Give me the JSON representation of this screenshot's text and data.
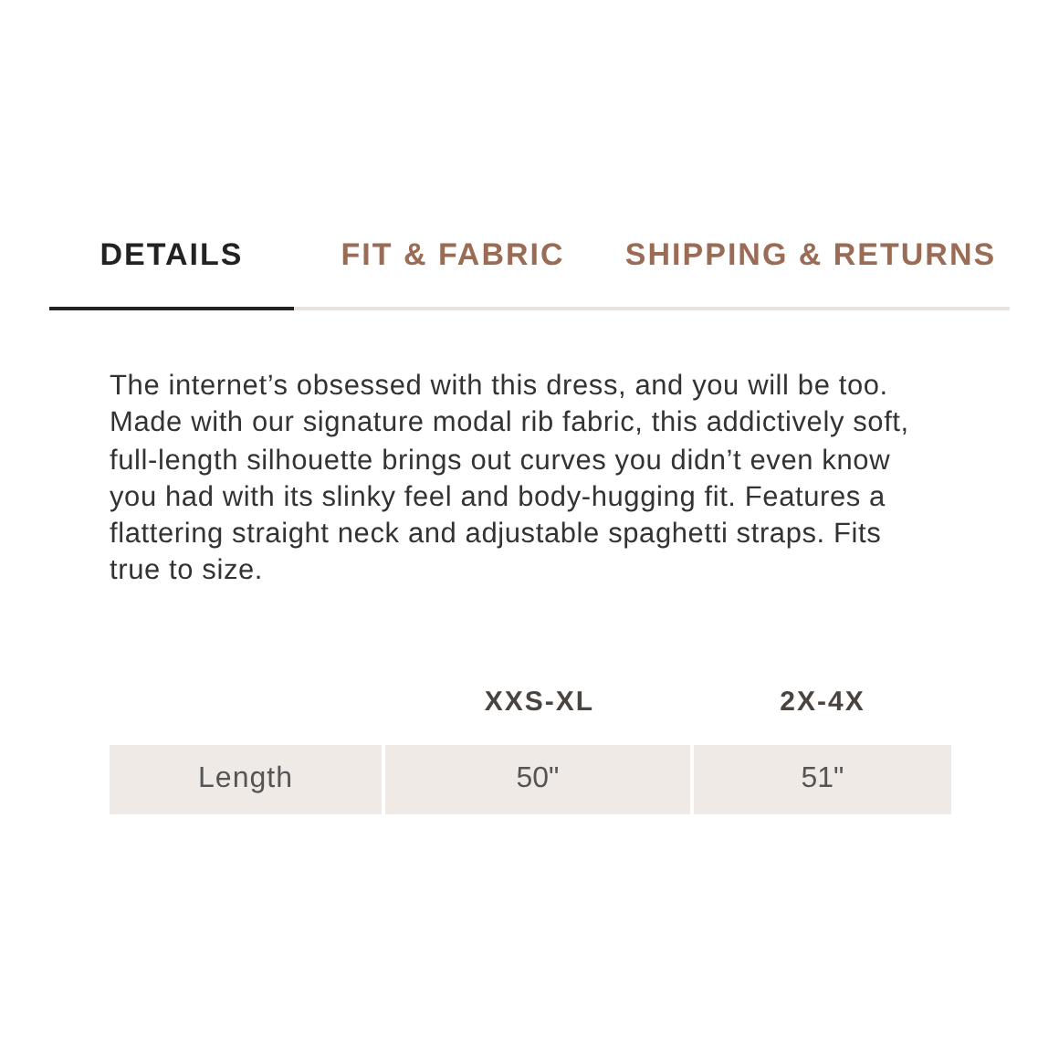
{
  "tabs": [
    {
      "label": "DETAILS",
      "selected": true
    },
    {
      "label": "FIT & FABRIC",
      "selected": false
    },
    {
      "label": "SHIPPING & RETURNS",
      "selected": false
    }
  ],
  "description": "The internet’s obsessed with this dress, and you will be too. Made with our signature modal rib fabric, this addictively soft, full-length silhouette brings out curves you didn’t even know you had with its slinky feel and body-hugging fit. Features a flattering straight neck and adjustable spaghetti straps. Fits true to size.",
  "size_table": {
    "columns": [
      "XXS-XL",
      "2X-4X"
    ],
    "rows": [
      {
        "label": "Length",
        "values": [
          "50\"",
          "51\""
        ]
      }
    ]
  }
}
